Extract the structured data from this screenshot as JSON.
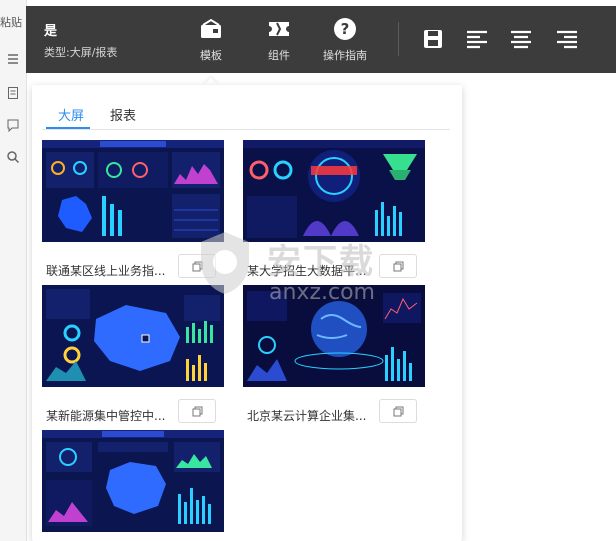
{
  "left_strip": {
    "edge_text": "粘贴",
    "tools": [
      "list-icon",
      "doc-icon",
      "comment-icon",
      "zoom-icon"
    ]
  },
  "toolbar": {
    "title": "是",
    "subtitle": "类型:大屏/报表",
    "buttons": [
      {
        "label": "模板",
        "icon": "template-icon"
      },
      {
        "label": "组件",
        "icon": "component-icon"
      },
      {
        "label": "操作指南",
        "icon": "help-icon"
      }
    ],
    "right_icons": [
      "save-icon",
      "align-left-icon",
      "align-center-icon",
      "align-right-icon"
    ]
  },
  "panel": {
    "tabs": [
      {
        "label": "大屏",
        "active": true
      },
      {
        "label": "报表",
        "active": false
      }
    ],
    "templates": [
      {
        "label": "联通某区线上业务指..."
      },
      {
        "label": "某大学招生大数据平..."
      },
      {
        "label": "某新能源集中管控中..."
      },
      {
        "label": "北京某云计算企业集..."
      },
      {
        "label": ""
      }
    ]
  },
  "watermark": {
    "text": "安下载",
    "sub": "anxz.com"
  },
  "colors": {
    "toolbar_bg": "#3c3c3c",
    "accent": "#2d8cf0",
    "thumb_bg": "#0b1550"
  }
}
